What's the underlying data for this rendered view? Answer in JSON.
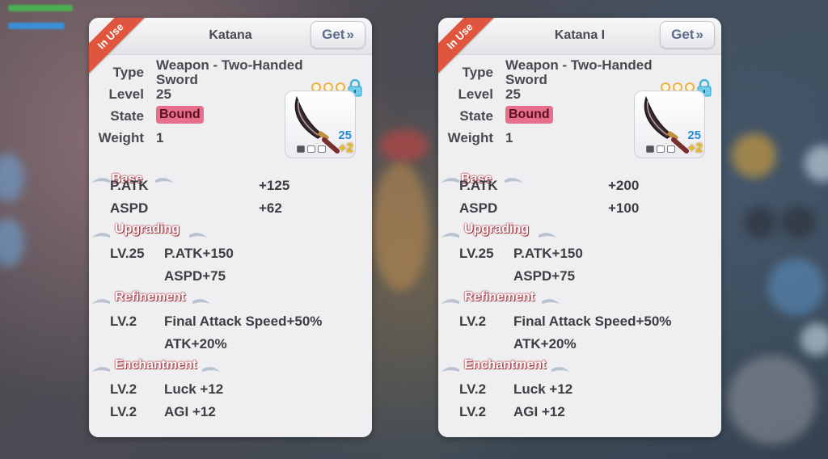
{
  "panels": [
    {
      "ribbon": "In Use",
      "title": "Katana",
      "get_label": "Get",
      "type_label": "Type",
      "type_value": "Weapon - Two-Handed",
      "type_value2": "Sword",
      "level_label": "Level",
      "level_value": "25",
      "state_label": "State",
      "state_value": "Bound",
      "weight_label": "Weight",
      "weight_value": "1",
      "item_level": "25",
      "item_refine": "+2",
      "base_title": "Base",
      "base_rows": [
        {
          "label": "P.ATK",
          "value": "+125"
        },
        {
          "label": "ASPD",
          "value": "+62"
        }
      ],
      "upgrading_title": "Upgrading",
      "upgrading_rows": [
        {
          "label": "LV.25",
          "value": "P.ATK+150"
        },
        {
          "label": "",
          "value": "ASPD+75"
        }
      ],
      "refinement_title": "Refinement",
      "refinement_rows": [
        {
          "label": "LV.2",
          "value": "Final Attack Speed+50%"
        },
        {
          "label": "",
          "value": "ATK+20%"
        }
      ],
      "enchant_title": "Enchantment",
      "enchant_rows": [
        {
          "label": "LV.2",
          "value": "Luck +12"
        },
        {
          "label": "LV.2",
          "value": "AGI +12"
        }
      ]
    },
    {
      "ribbon": "In Use",
      "title": "Katana I",
      "get_label": "Get",
      "type_label": "Type",
      "type_value": "Weapon - Two-Handed",
      "type_value2": "Sword",
      "level_label": "Level",
      "level_value": "25",
      "state_label": "State",
      "state_value": "Bound",
      "weight_label": "Weight",
      "weight_value": "1",
      "item_level": "25",
      "item_refine": "+2",
      "base_title": "Base",
      "base_rows": [
        {
          "label": "P.ATK",
          "value": "+200"
        },
        {
          "label": "ASPD",
          "value": "+100"
        }
      ],
      "upgrading_title": "Upgrading",
      "upgrading_rows": [
        {
          "label": "LV.25",
          "value": "P.ATK+150"
        },
        {
          "label": "",
          "value": "ASPD+75"
        }
      ],
      "refinement_title": "Refinement",
      "refinement_rows": [
        {
          "label": "LV.2",
          "value": "Final Attack Speed+50%"
        },
        {
          "label": "",
          "value": "ATK+20%"
        }
      ],
      "enchant_title": "Enchantment",
      "enchant_rows": [
        {
          "label": "LV.2",
          "value": "Luck +12"
        },
        {
          "label": "LV.2",
          "value": "AGI +12"
        }
      ]
    }
  ],
  "colors": {
    "ribbon": "#e0553d",
    "bound_badge": "#e86f8c",
    "section_outline": "#b0414d",
    "item_level": "#1f8ad6",
    "item_refine": "#f2c21b"
  },
  "icons": [
    "sword-icon",
    "lock-icon",
    "star-icon",
    "double-chevron-right-icon",
    "wing-icon"
  ]
}
